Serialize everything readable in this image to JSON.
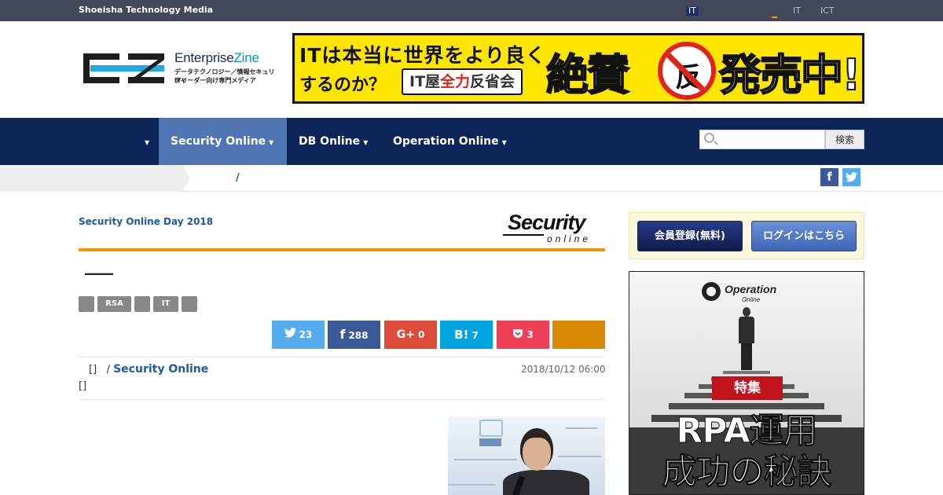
{
  "topbar": {
    "brand": "Shoeisha Technology Media",
    "links": [
      "IT",
      "IT",
      "ICT"
    ]
  },
  "logo": {
    "name_a": "Enterprise",
    "name_b": "Zine",
    "tagline_1": "データテクノロジー／情報セキュリティ",
    "tagline_2": "ITリーダー向け専門メディア"
  },
  "banner": {
    "line1": "ITは本当に世界をより良く",
    "line2": "するのか？",
    "box_a": "IT屋",
    "box_b": "全力",
    "box_c": "反省会",
    "big_a": "絶賛",
    "big_b": "発売中!",
    "circle": "反"
  },
  "nav": {
    "caret": "▼",
    "items": [
      "Security Online",
      "DB Online",
      "Operation Online"
    ]
  },
  "search": {
    "placeholder": "",
    "button": "検索"
  },
  "breadcrumb": {
    "sep": "/"
  },
  "social_icons": {
    "facebook": "f",
    "twitter": "t"
  },
  "article": {
    "category": "Security Online Day 2018",
    "section_logo": "Security",
    "section_logo_sub": "online",
    "title": "――",
    "tags": [
      "",
      "RSA",
      "",
      "IT",
      ""
    ],
    "share": {
      "twitter": {
        "icon": "twitter-bird",
        "count": "23"
      },
      "facebook": {
        "icon": "f",
        "count": "288"
      },
      "gplus": {
        "icon": "G+",
        "count": "0"
      },
      "hatena": {
        "icon": "B!",
        "count": "7"
      },
      "pocket": {
        "icon": "pocket",
        "count": "3"
      }
    },
    "author_bracket": "[]",
    "author_slash": "/",
    "author_org": "Security Online",
    "date": "2018/10/12 06:00",
    "bracket2": "[]"
  },
  "sidebar": {
    "register": "会員登録(無料)",
    "login": "ログインはこちら",
    "ad": {
      "brand": "Operation",
      "brand_sub": "Online",
      "label": "特集",
      "line1": "RPA運用",
      "line2": "成功の秘訣"
    }
  },
  "colors": {
    "topbar": "#424759",
    "nav": "#0b2558",
    "nav_active": "#4f76b3",
    "accent": "#f39800",
    "link": "#1d5aa6",
    "twitter": "#55acee",
    "facebook": "#3b5998",
    "gplus": "#dd4b39",
    "hatena": "#00a4de",
    "pocket": "#ee4056",
    "share_extra": "#d88a04"
  }
}
